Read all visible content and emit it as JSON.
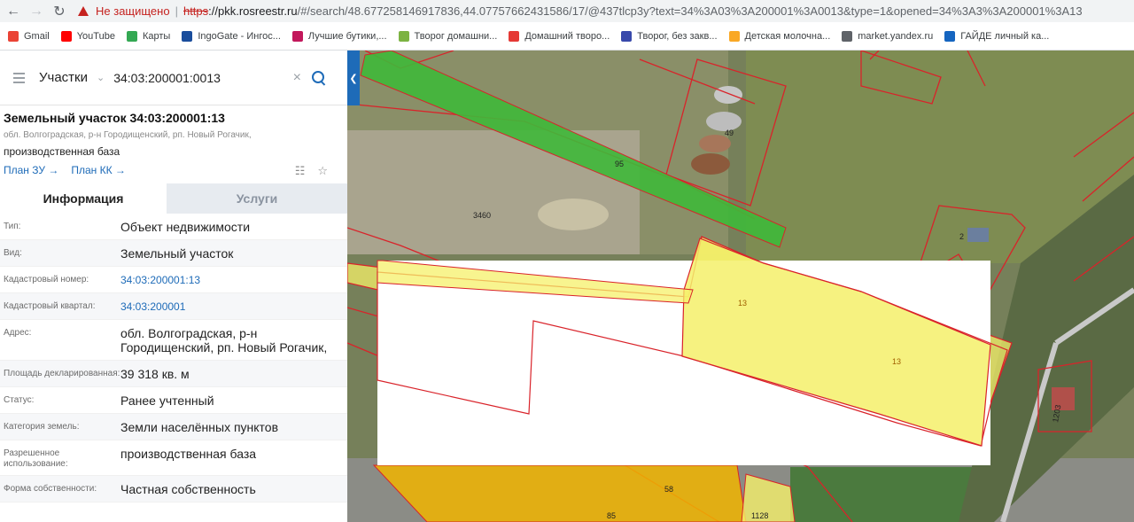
{
  "browser": {
    "security_label": "Не защищено",
    "url_scheme": "https",
    "url_host": "://pkk.rosreestr.ru",
    "url_rest": "/#/search/48.677258146917836,44.07757662431586/17/@437tlcp3y?text=34%3A03%3A200001%3A0013&type=1&opened=34%3A3%3A200001%3A13"
  },
  "bookmarks": [
    {
      "label": "Gmail",
      "color": "#ea4335"
    },
    {
      "label": "YouTube",
      "color": "#ff0000"
    },
    {
      "label": "Карты",
      "color": "#34a853"
    },
    {
      "label": "IngoGate - Ингос...",
      "color": "#1a4d9c"
    },
    {
      "label": "Лучшие бутики,...",
      "color": "#c2185b"
    },
    {
      "label": "Творог домашни...",
      "color": "#7cb342"
    },
    {
      "label": "Домашний творо...",
      "color": "#e53935"
    },
    {
      "label": "Творог, без закв...",
      "color": "#3949ab"
    },
    {
      "label": "Детская молочна...",
      "color": "#f9a825"
    },
    {
      "label": "market.yandex.ru",
      "color": "#5f6368"
    },
    {
      "label": "ГАЙДЕ личный ка...",
      "color": "#1565c0"
    }
  ],
  "search": {
    "type_label": "Участки",
    "query": "34:03:200001:0013",
    "clear_icon": "×"
  },
  "parcel": {
    "title": "Земельный участок 34:03:200001:13",
    "address_short": "обл. Волгоградская, р-н Городищенский, рп. Новый Рогачик,",
    "purpose": "производственная база",
    "plan_zu": "План ЗУ",
    "plan_kk": "План КК"
  },
  "tabs": {
    "info": "Информация",
    "services": "Услуги"
  },
  "details": [
    {
      "label": "Тип:",
      "value": "Объект недвижимости",
      "link": false
    },
    {
      "label": "Вид:",
      "value": "Земельный участок",
      "link": false
    },
    {
      "label": "Кадастровый номер:",
      "value": "34:03:200001:13",
      "link": true
    },
    {
      "label": "Кадастровый квартал:",
      "value": "34:03:200001",
      "link": true
    },
    {
      "label": "Адрес:",
      "value": "обл. Волгоградская, р-н Городищенский, рп. Новый Рогачик,",
      "link": false
    },
    {
      "label": "Площадь декларированная:",
      "value": "39 318 кв. м",
      "link": false
    },
    {
      "label": "Статус:",
      "value": "Ранее учтенный",
      "link": false
    },
    {
      "label": "Категория земель:",
      "value": "Земли населённых пунктов",
      "link": false
    },
    {
      "label": "Разрешенное использование:",
      "value": "производственная база",
      "link": false
    },
    {
      "label": "Форма собственности:",
      "value": "Частная собственность",
      "link": false
    }
  ],
  "map": {
    "labels": {
      "l95": "95",
      "l49": "49",
      "l3460": "3460",
      "l2": "2",
      "l13a": "13",
      "l13b": "13",
      "l58": "58",
      "l85": "85",
      "l1128": "1128",
      "l1203": "1203"
    },
    "colors": {
      "parcel_border": "#d9232a",
      "selected_fill": "#f5f06a",
      "green_fill": "#3fb83a",
      "orange_fill": "#f0b400"
    }
  }
}
